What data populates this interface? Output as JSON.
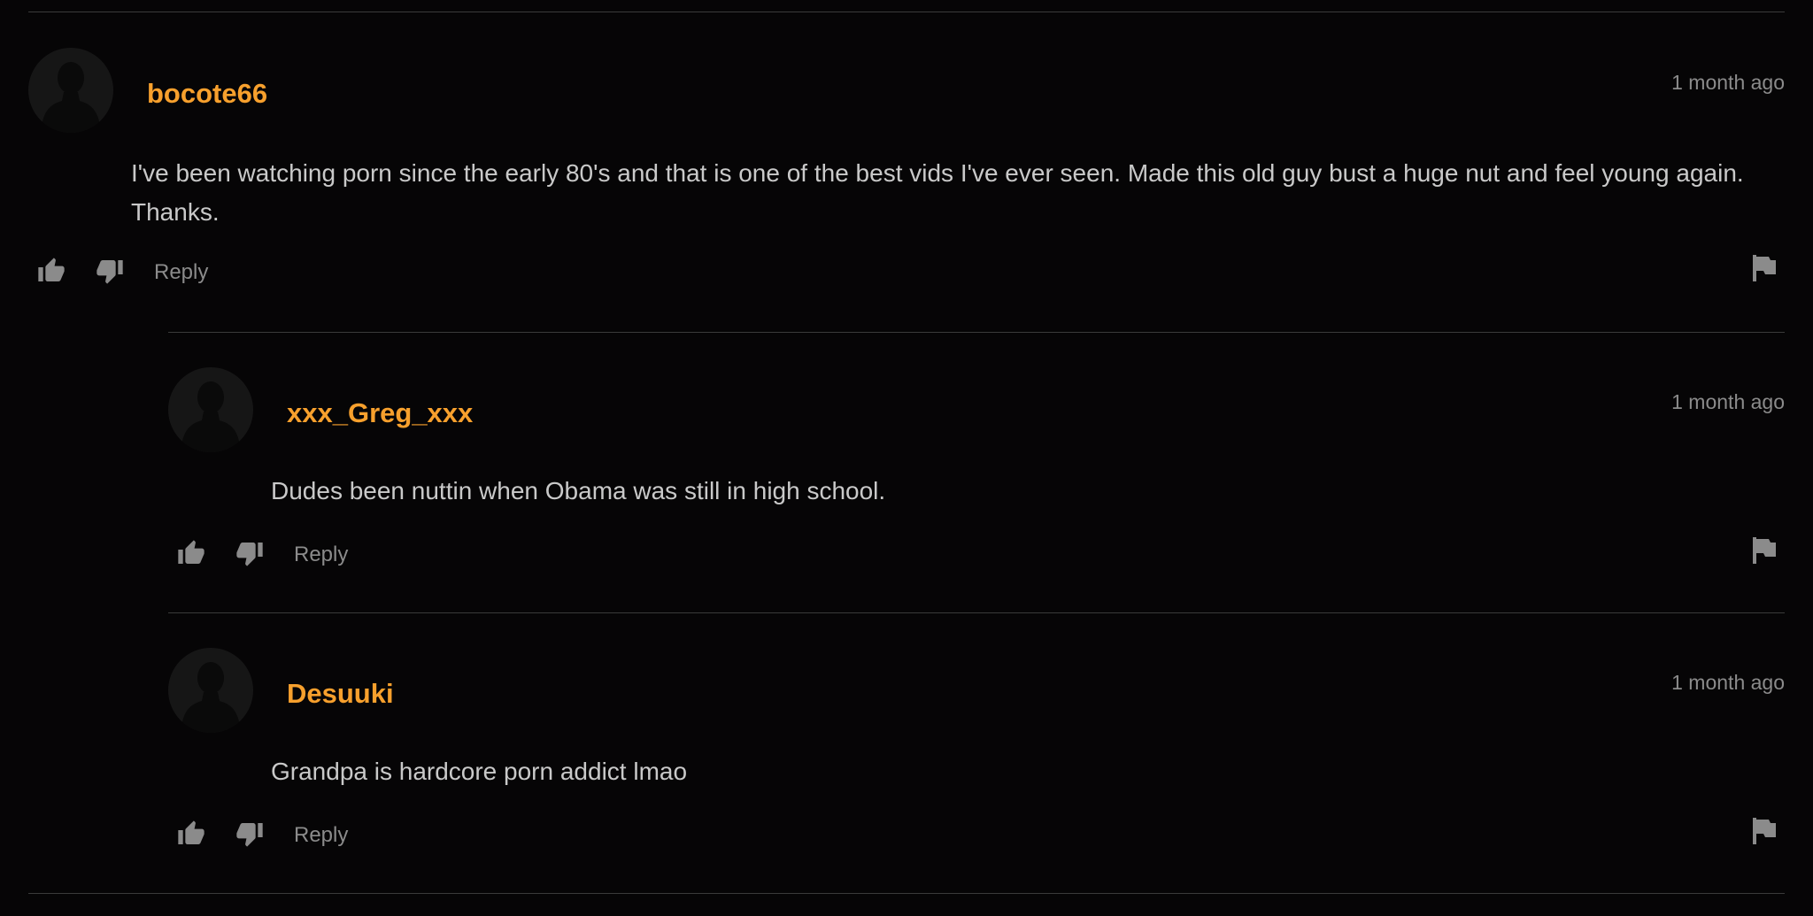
{
  "comments": [
    {
      "username": "bocote66",
      "timestamp": "1 month ago",
      "text": "I've been watching porn since the early 80's and that is one of the best vids I've ever seen. Made this old guy bust a huge nut and feel young again. Thanks.",
      "reply_label": "Reply"
    },
    {
      "username": "xxx_Greg_xxx",
      "timestamp": "1 month ago",
      "text": "Dudes been nuttin when Obama was still in high school.",
      "reply_label": "Reply"
    },
    {
      "username": "Desuuki",
      "timestamp": "1 month ago",
      "text": "Grandpa is hardcore porn addict lmao",
      "reply_label": "Reply"
    }
  ],
  "icons": {
    "avatar": "user-silhouette-icon",
    "like": "thumbs-up-icon",
    "dislike": "thumbs-down-icon",
    "flag": "flag-icon"
  },
  "colors": {
    "background": "#060506",
    "username": "#f7a02d",
    "body_text": "#c9c9c9",
    "muted": "#8b8b8b",
    "divider": "#3a3a3a"
  }
}
